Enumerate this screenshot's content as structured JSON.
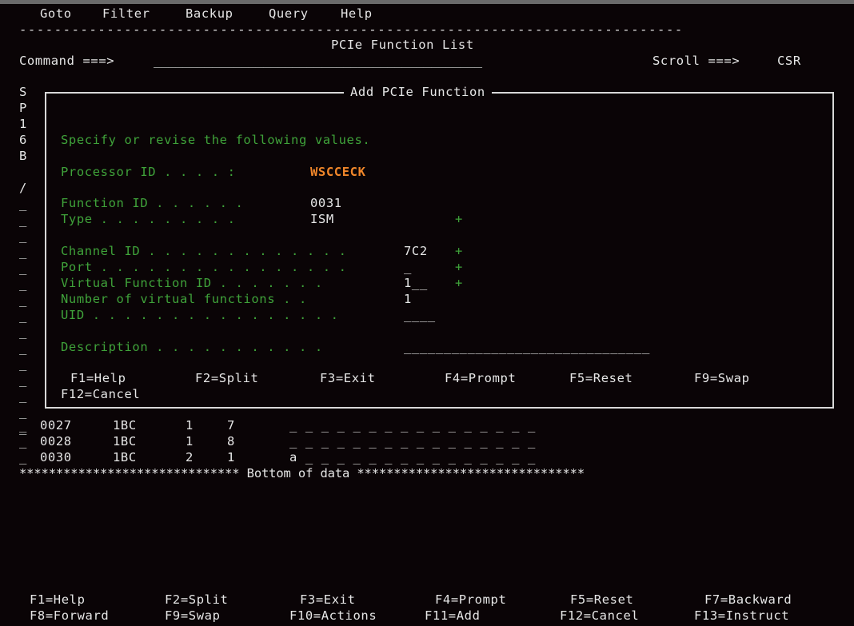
{
  "menu": [
    "Goto",
    "Filter",
    "Backup",
    "Query",
    "Help"
  ],
  "separator": "----------------------------------------------------------------------------",
  "panel_title": "PCIe Function List",
  "command": {
    "label": "Command ===>",
    "value": "_____________________________________________",
    "scroll_label": "Scroll ===>",
    "scroll_value": "CSR"
  },
  "left_column": [
    "S",
    "P",
    "1",
    "6",
    "B",
    "",
    "/",
    "_",
    "_",
    "_",
    "_",
    "_",
    "_",
    "_",
    "_",
    "_",
    "_",
    "_",
    "_",
    "_",
    "_",
    "_"
  ],
  "dialog": {
    "title": "Add PCIe Function",
    "instruction": "Specify or revise the following values.",
    "processor_id": {
      "label": "Processor ID . . . . :",
      "value": "WSCCECK"
    },
    "function_id": {
      "label": "Function ID . . . . . .",
      "value": "0031"
    },
    "type": {
      "label": "Type . . . . . . . . .",
      "value": "ISM",
      "prompt": "+"
    },
    "channel_id": {
      "label": "Channel ID . . . . . . . . . . . . .",
      "value": "7C2",
      "prompt": "+"
    },
    "port": {
      "label": "Port . . . . . . . . . . . . . . . .",
      "value": "_",
      "prompt": "+"
    },
    "virtual_function_id": {
      "label": "Virtual Function ID . . . . . . .",
      "value": "1__",
      "prompt": "+"
    },
    "num_virtual_functions": {
      "label": "Number of virtual functions . .",
      "value": "1"
    },
    "uid": {
      "label": "UID . . . . . . . . . . . . . . . .",
      "value": "____"
    },
    "description": {
      "label": "Description . . . . . . . . . . .",
      "value": "_______________________________"
    },
    "fkeys_row1": [
      "F1=Help",
      "F2=Split",
      "F3=Exit",
      "F4=Prompt",
      "F5=Reset",
      "F9=Swap"
    ],
    "fkeys_row2": [
      "F12=Cancel"
    ]
  },
  "rows": [
    {
      "sel": "_",
      "id": "0027",
      "ch": "1BC",
      "a": "1",
      "b": "7",
      "desc": "_ _ _ _ _ _ _ _ _ _ _ _ _ _ _ _"
    },
    {
      "sel": "_",
      "id": "0028",
      "ch": "1BC",
      "a": "1",
      "b": "8",
      "desc": "_ _ _ _ _ _ _ _ _ _ _ _ _ _ _ _"
    },
    {
      "sel": "_",
      "id": "0030",
      "ch": "1BC",
      "a": "2",
      "b": "1",
      "desc": "a _ _ _ _ _ _ _ _ _ _ _ _ _ _ _"
    }
  ],
  "bottom_of_data": "****************************** Bottom of data *******************************",
  "fkeys": {
    "row1": [
      "F1=Help",
      "F2=Split",
      "F3=Exit",
      "F4=Prompt",
      "F5=Reset",
      "F7=Backward"
    ],
    "row2": [
      "F8=Forward",
      "F9=Swap",
      "F10=Actions",
      "F11=Add",
      "F12=Cancel",
      "F13=Instruct"
    ]
  }
}
